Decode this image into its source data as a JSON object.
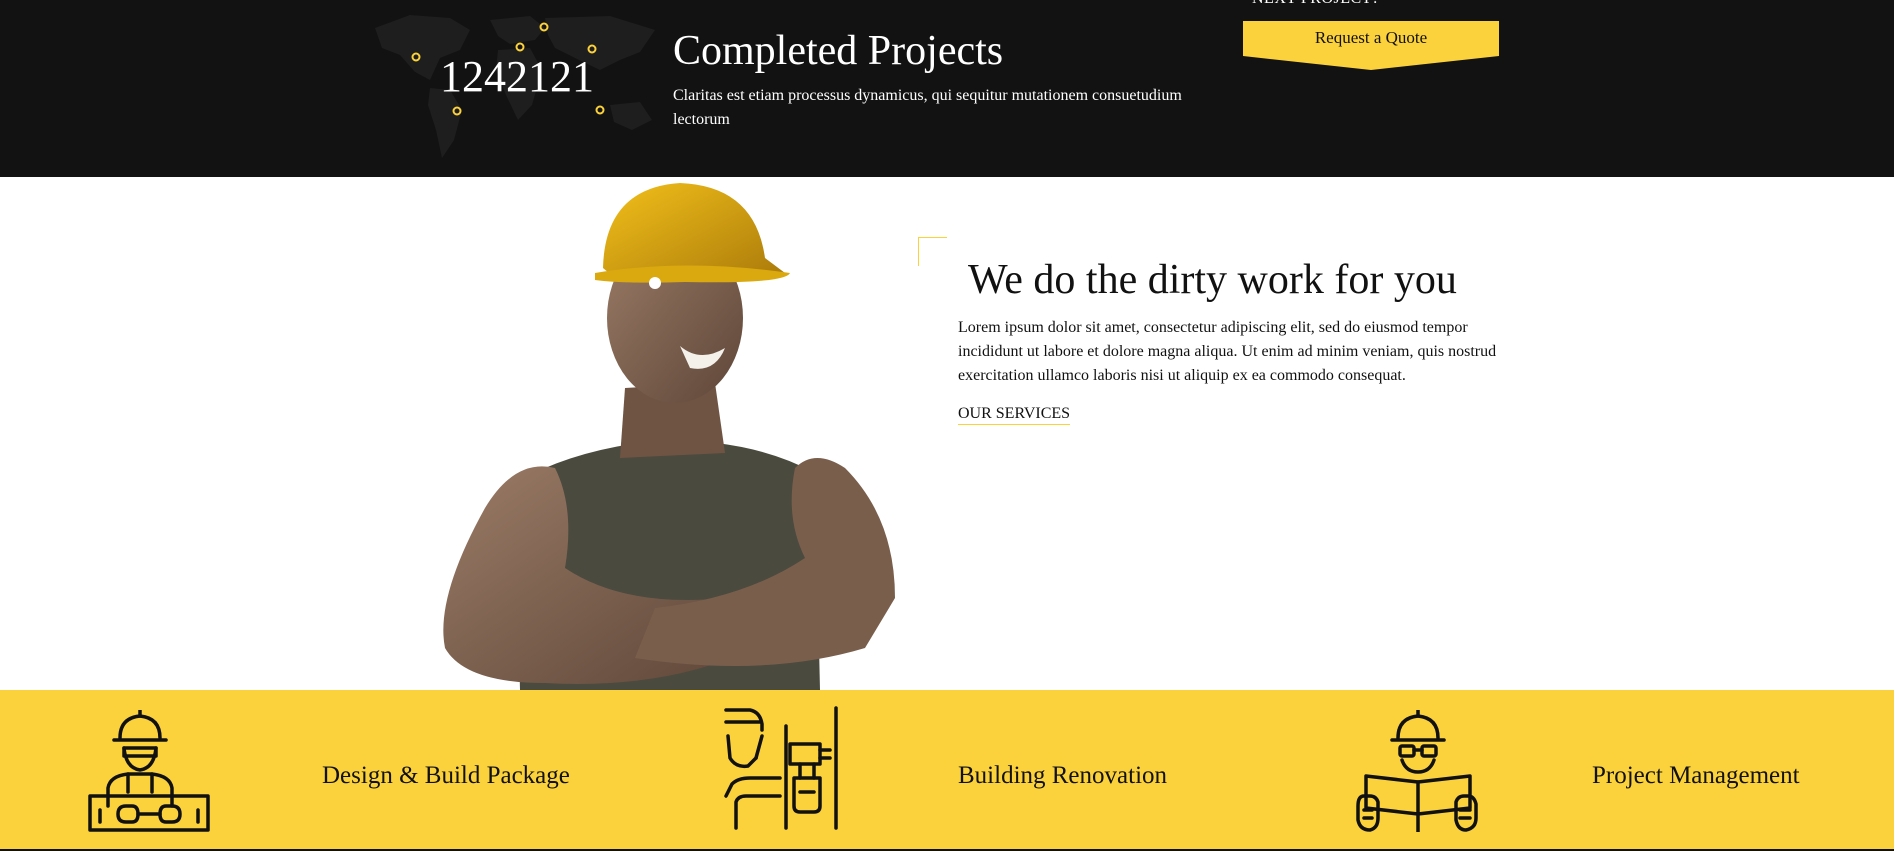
{
  "stats": {
    "counter": "1242121",
    "title": "Completed Projects",
    "description": "Claritas est etiam processus dynamicus, qui sequitur mutationem consuetudium lectorum"
  },
  "cta": {
    "next_label": "NEXT PROJECT?",
    "quote_button": "Request a Quote"
  },
  "hero": {
    "title": "We do the dirty work for you",
    "text": "Lorem ipsum dolor sit amet, consectetur adipiscing elit, sed do eiusmod tempor incididunt ut labore et dolore magna aliqua. Ut enim ad minim veniam, quis nostrud exercitation ullamco laboris nisi ut aliquip ex ea commodo consequat.",
    "link": "OUR SERVICES"
  },
  "services": [
    {
      "label": "Design & Build Package",
      "icon": "worker-with-toolbox-icon"
    },
    {
      "label": "Building Renovation",
      "icon": "worker-with-drill-icon"
    },
    {
      "label": "Project Management",
      "icon": "worker-reading-plans-icon"
    }
  ],
  "colors": {
    "accent": "#fcd23c",
    "dark": "#121212",
    "text": "#111111"
  }
}
